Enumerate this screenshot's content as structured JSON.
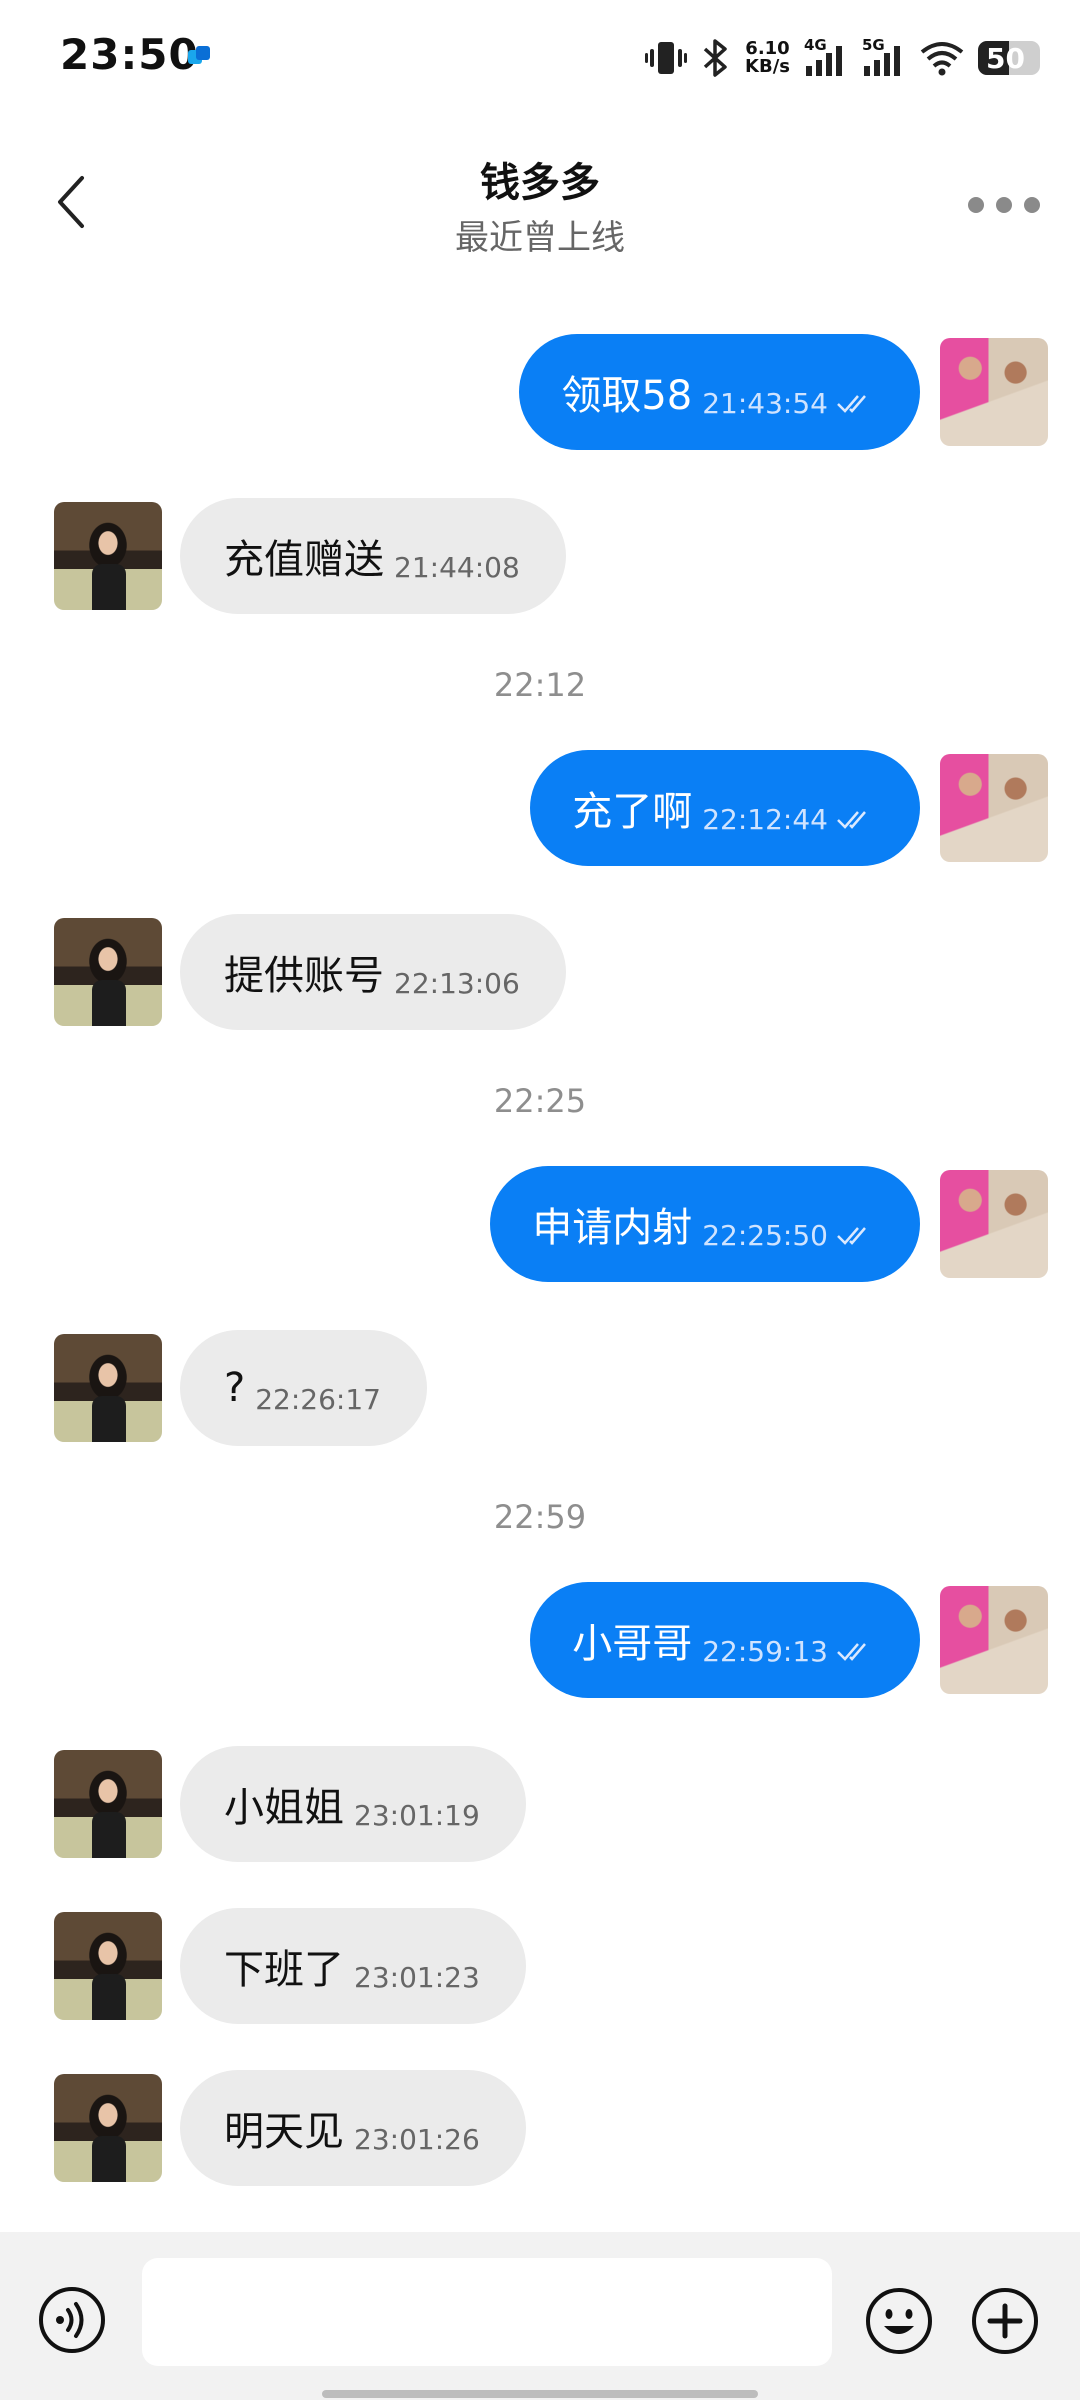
{
  "status_bar": {
    "time": "23:50",
    "net_speed_value": "6.10",
    "net_speed_unit": "KB/s",
    "net1_label": "4G",
    "net2_label": "5G",
    "battery": "50",
    "icons": [
      "app-notification-icon",
      "vibrate-icon",
      "bluetooth-icon",
      "signal-icon",
      "wifi-icon",
      "battery-icon"
    ]
  },
  "header": {
    "title": "钱多多",
    "subtitle": "最近曾上线"
  },
  "messages": [
    {
      "side": "out",
      "text": "领取58",
      "time": "21:43:54",
      "read": true
    },
    {
      "side": "in",
      "text": "充值赠送",
      "time": "21:44:08"
    },
    {
      "type": "separator",
      "text": "22:12"
    },
    {
      "side": "out",
      "text": "充了啊",
      "time": "22:12:44",
      "read": true
    },
    {
      "side": "in",
      "text": "提供账号",
      "time": "22:13:06"
    },
    {
      "type": "separator",
      "text": "22:25"
    },
    {
      "side": "out",
      "text": "申请内射",
      "time": "22:25:50",
      "read": true
    },
    {
      "side": "in",
      "text": "?",
      "time": "22:26:17"
    },
    {
      "type": "separator",
      "text": "22:59"
    },
    {
      "side": "out",
      "text": "小哥哥",
      "time": "22:59:13",
      "read": true
    },
    {
      "side": "in",
      "text": "小姐姐",
      "time": "23:01:19"
    },
    {
      "side": "in",
      "text": "下班了",
      "time": "23:01:23"
    },
    {
      "side": "in",
      "text": "明天见",
      "time": "23:01:26"
    }
  ],
  "input": {
    "value": "",
    "placeholder": ""
  },
  "colors": {
    "outgoing_bubble": "#0a7ff5",
    "incoming_bubble": "#ebebeb",
    "background": "#ffffff",
    "input_bar": "#f2f2f2"
  }
}
